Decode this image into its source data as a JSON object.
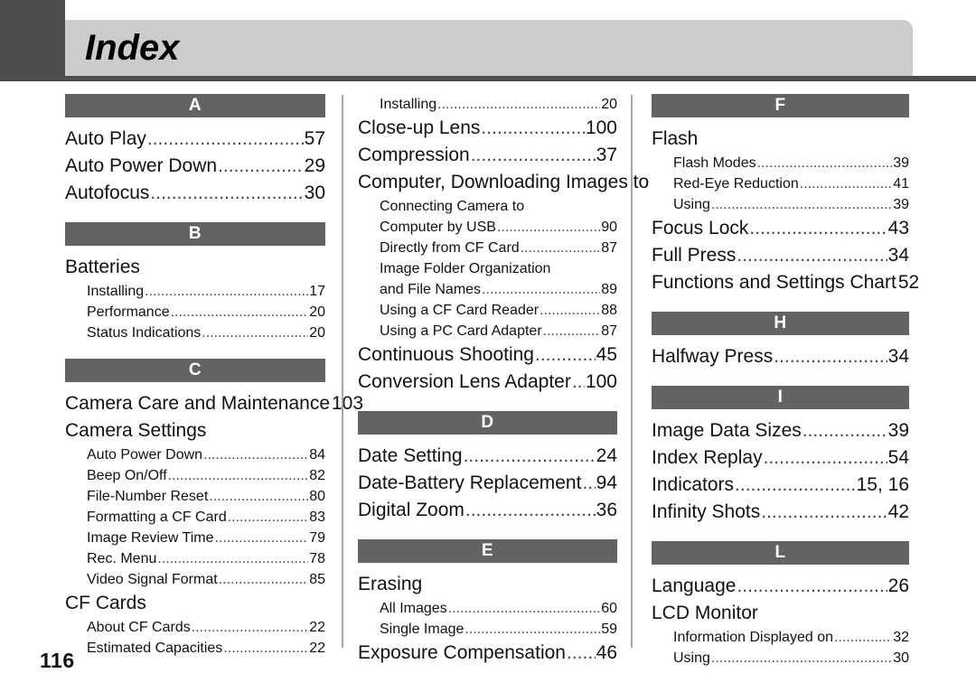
{
  "header": {
    "title": "Index",
    "tab_color": "#4d4d4d",
    "band_color": "#cccccc",
    "rule_color": "#4f4f4f"
  },
  "letter_band_color": "#636363",
  "page_number": "116",
  "columns": [
    {
      "name": "column-1",
      "blocks": [
        {
          "letter": "A",
          "entries": [
            {
              "level": "main",
              "label": "Auto Play",
              "page": "57",
              "leader": true
            },
            {
              "level": "main",
              "label": "Auto Power Down",
              "page": "29",
              "leader": true
            },
            {
              "level": "main",
              "label": "Autofocus",
              "page": "30",
              "leader": true
            }
          ]
        },
        {
          "letter": "B",
          "entries": [
            {
              "level": "main",
              "label": "Batteries",
              "page": "",
              "leader": false
            },
            {
              "level": "sub",
              "label": "Installing",
              "page": "17",
              "leader": true
            },
            {
              "level": "sub",
              "label": "Performance",
              "page": "20",
              "leader": true
            },
            {
              "level": "sub",
              "label": "Status Indications",
              "page": "20",
              "leader": true
            }
          ]
        },
        {
          "letter": "C",
          "entries": [
            {
              "level": "main",
              "label": "Camera Care and Maintenance",
              "page": "103",
              "leader": true
            },
            {
              "level": "main",
              "label": "Camera Settings",
              "page": "",
              "leader": false
            },
            {
              "level": "sub",
              "label": "Auto Power Down",
              "page": "84",
              "leader": true
            },
            {
              "level": "sub",
              "label": "Beep On/Off",
              "page": "82",
              "leader": true
            },
            {
              "level": "sub",
              "label": "File-Number Reset",
              "page": "80",
              "leader": true
            },
            {
              "level": "sub",
              "label": "Formatting a CF Card",
              "page": "83",
              "leader": true
            },
            {
              "level": "sub",
              "label": "Image Review Time",
              "page": "79",
              "leader": true
            },
            {
              "level": "sub",
              "label": "Rec. Menu",
              "page": "78",
              "leader": true
            },
            {
              "level": "sub",
              "label": "Video Signal Format",
              "page": "85",
              "leader": true
            },
            {
              "level": "main",
              "label": "CF Cards",
              "page": "",
              "leader": false
            },
            {
              "level": "sub",
              "label": "About CF Cards",
              "page": "22",
              "leader": true
            },
            {
              "level": "sub",
              "label": "Estimated Capacities",
              "page": "22",
              "leader": true
            }
          ]
        }
      ]
    },
    {
      "name": "column-2",
      "blocks": [
        {
          "letter": "",
          "entries": [
            {
              "level": "sub",
              "label": "Installing",
              "page": "20",
              "leader": true
            },
            {
              "level": "main",
              "label": "Close-up Lens",
              "page": "100",
              "leader": true
            },
            {
              "level": "main",
              "label": "Compression",
              "page": "37",
              "leader": true
            },
            {
              "level": "main",
              "label": "Computer, Downloading Images to",
              "page": "",
              "leader": false
            },
            {
              "level": "sub",
              "label": "Connecting Camera to",
              "page": "",
              "leader": false
            },
            {
              "level": "sub",
              "label": "Computer by USB",
              "page": "90",
              "leader": true
            },
            {
              "level": "sub",
              "label": "Directly from CF Card",
              "page": "87",
              "leader": true
            },
            {
              "level": "sub",
              "label": "Image Folder Organization",
              "page": "",
              "leader": false
            },
            {
              "level": "sub",
              "label": "and File Names",
              "page": "89",
              "leader": true
            },
            {
              "level": "sub",
              "label": "Using a CF Card Reader",
              "page": "88",
              "leader": true
            },
            {
              "level": "sub",
              "label": "Using a PC Card Adapter",
              "page": "87",
              "leader": true
            },
            {
              "level": "main",
              "label": "Continuous Shooting",
              "page": "45",
              "leader": true
            },
            {
              "level": "main",
              "label": "Conversion Lens Adapter",
              "page": "100",
              "leader": true
            }
          ]
        },
        {
          "letter": "D",
          "entries": [
            {
              "level": "main",
              "label": "Date Setting",
              "page": "24",
              "leader": true
            },
            {
              "level": "main",
              "label": "Date-Battery Replacement",
              "page": "94",
              "leader": true
            },
            {
              "level": "main",
              "label": "Digital Zoom",
              "page": "36",
              "leader": true
            }
          ]
        },
        {
          "letter": "E",
          "entries": [
            {
              "level": "main",
              "label": "Erasing",
              "page": "",
              "leader": false
            },
            {
              "level": "sub",
              "label": "All Images",
              "page": "60",
              "leader": true
            },
            {
              "level": "sub",
              "label": "Single Image",
              "page": "59",
              "leader": true
            },
            {
              "level": "main",
              "label": "Exposure Compensation",
              "page": "46",
              "leader": true
            }
          ]
        }
      ]
    },
    {
      "name": "column-3",
      "blocks": [
        {
          "letter": "F",
          "entries": [
            {
              "level": "main",
              "label": "Flash",
              "page": "",
              "leader": false
            },
            {
              "level": "sub",
              "label": "Flash Modes",
              "page": "39",
              "leader": true
            },
            {
              "level": "sub",
              "label": "Red-Eye Reduction",
              "page": "41",
              "leader": true
            },
            {
              "level": "sub",
              "label": "Using",
              "page": "39",
              "leader": true
            },
            {
              "level": "main",
              "label": "Focus Lock",
              "page": "43",
              "leader": true
            },
            {
              "level": "main",
              "label": "Full Press",
              "page": "34",
              "leader": true
            },
            {
              "level": "main",
              "label": "Functions and Settings Chart",
              "page": "52",
              "leader": true
            }
          ]
        },
        {
          "letter": "H",
          "entries": [
            {
              "level": "main",
              "label": "Halfway Press",
              "page": "34",
              "leader": true
            }
          ]
        },
        {
          "letter": "I",
          "entries": [
            {
              "level": "main",
              "label": "Image Data Sizes",
              "page": "39",
              "leader": true
            },
            {
              "level": "main",
              "label": "Index Replay",
              "page": "54",
              "leader": true
            },
            {
              "level": "main",
              "label": "Indicators",
              "page": "15, 16",
              "leader": true
            },
            {
              "level": "main",
              "label": "Infinity Shots",
              "page": "42",
              "leader": true
            }
          ]
        },
        {
          "letter": "L",
          "entries": [
            {
              "level": "main",
              "label": "Language",
              "page": "26",
              "leader": true
            },
            {
              "level": "main",
              "label": "LCD Monitor",
              "page": "",
              "leader": false
            },
            {
              "level": "sub",
              "label": "Information Displayed on",
              "page": "32",
              "leader": true
            },
            {
              "level": "sub",
              "label": "Using",
              "page": "30",
              "leader": true
            }
          ]
        }
      ]
    }
  ]
}
